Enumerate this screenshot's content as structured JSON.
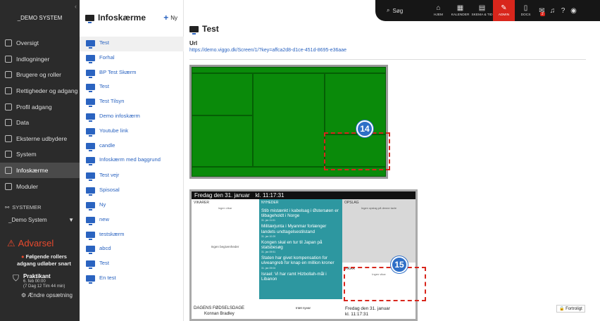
{
  "sidebar": {
    "org": "_DEMO SYSTEM",
    "items": [
      {
        "label": "Oversigt",
        "icon": "dashboard-icon"
      },
      {
        "label": "Indlogninger",
        "icon": "login-icon"
      },
      {
        "label": "Brugere og roller",
        "icon": "users-icon"
      },
      {
        "label": "Rettigheder og adgang",
        "icon": "key-icon"
      },
      {
        "label": "Profil adgang",
        "icon": "profile-icon"
      },
      {
        "label": "Data",
        "icon": "database-icon"
      },
      {
        "label": "Eksterne udbydere",
        "icon": "building-icon"
      },
      {
        "label": "System",
        "icon": "gear-icon"
      },
      {
        "label": "Infoskærme",
        "icon": "monitor-icon"
      },
      {
        "label": "Moduler",
        "icon": "modules-icon"
      }
    ],
    "systems_label": "SYSTEMER",
    "system_selected": "_Demo System",
    "warning_title": "Advarsel",
    "warning_text": "Følgende rollers adgang udløber snart",
    "intern_title": "Praktikant",
    "intern_date": "6. feb 00:00",
    "intern_remaining": "(7 Dag 12 Tim 44 min)",
    "change_label": "Ændre opsætning"
  },
  "list": {
    "title": "Infoskærme",
    "new_label": "Ny",
    "items": [
      "Test",
      "Forhal",
      "BP Test Skærm",
      "Test",
      "Test Tilsyn",
      "Demo infoskærm",
      "Youtube link",
      "candle",
      "Infoskærm med baggrund",
      "Test vejr",
      "Spisosal",
      "Ny",
      "new",
      "testskærm",
      "abcd",
      "Test",
      "En test"
    ]
  },
  "topbar": {
    "search_label": "Søg",
    "items": [
      {
        "label": "HJEM",
        "icon": "home-icon"
      },
      {
        "label": "KALENDER",
        "icon": "calendar-icon"
      },
      {
        "label": "SKEMA & TID",
        "icon": "schedule-icon"
      },
      {
        "label": "ADMIN",
        "icon": "wrench-icon"
      },
      {
        "label": "DOCS",
        "icon": "docs-icon"
      }
    ],
    "mail_badge": "2"
  },
  "main": {
    "title": "Test",
    "url_label": "Url",
    "url": "https://demo.viggo.dk/Screen/1/?key=affca2d8-d1ce-451d-8695-e36aae"
  },
  "preview2": {
    "header_date": "Fredag den 31. januar",
    "header_time": "kl. 11:17:31",
    "vikarer_title": "VIKARER",
    "vikarer_sub": "Ingen vikar",
    "vikarer_mid": "Ingen begivenheder",
    "nyheder_title": "NYHEDER",
    "news": [
      {
        "title": "Stib mistænkt i kabelsag i Østersøen er tilbageholdt i Norge",
        "date": "31. jan 11:01"
      },
      {
        "title": "Militærjunta i Myanmar forlænger landets undtagelsestilstand",
        "date": "31. jan 10:29"
      },
      {
        "title": "Kongen skal en tur til Japan på statsbesøg",
        "date": "31. jan 09:51"
      },
      {
        "title": "Staten har givet kompensation for ulveangreb for knap en million kroner",
        "date": "31. jan 09:04"
      },
      {
        "title": "Israel: Vi har ramt Hizbollah-mål i Libanon",
        "date": ""
      }
    ],
    "opslag_title": "OPSLAG",
    "opslag_sub": "Ingen opslag på denne tavle",
    "vikar_title": "VIKAR",
    "vikar_sub": "Ingen vikar",
    "bday_title": "DAGENS FØDSELSDAGE",
    "bday_name": "Konnan Bradley",
    "intet_nyt": "Intet nyvar",
    "footer_date": "Fredag den 31. januar",
    "footer_time": "kl. 11:17:31"
  },
  "annotations": {
    "a14": "14",
    "a15": "15"
  },
  "fortrolig": "Fortroligt",
  "colors": {
    "accent": "#2a63c0",
    "admin": "#d8261c",
    "green": "#0a8a0a",
    "teal": "#2d97a0"
  }
}
